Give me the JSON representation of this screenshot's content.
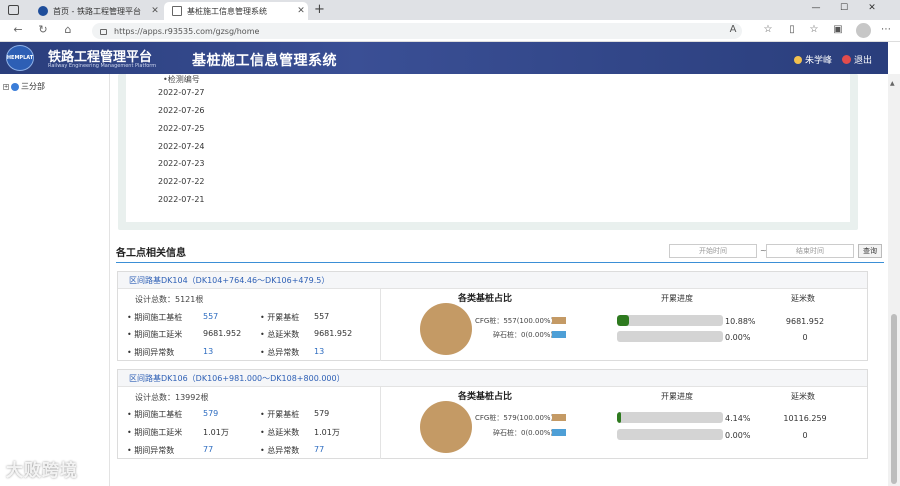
{
  "browser": {
    "tabs": [
      {
        "title": "首页 - 铁路工程管理平台"
      },
      {
        "title": "基桩施工信息管理系统"
      }
    ],
    "url": "https://apps.r93535.com/gzsg/home"
  },
  "header": {
    "logo_text": "HEMPLAT",
    "brand": "铁路工程管理平台",
    "brand_sub": "Railway Engineering Management Platform",
    "system_title": "基桩施工信息管理系统",
    "user_name": "朱学峰",
    "logout": "退出"
  },
  "tree": {
    "root_label": "三分部"
  },
  "date_panel": {
    "header": "•检测编号",
    "dates": [
      "2022-07-27",
      "2022-07-26",
      "2022-07-25",
      "2022-07-24",
      "2022-07-23",
      "2022-07-22",
      "2022-07-21"
    ]
  },
  "section": {
    "title": "各工点相关信息",
    "start_placeholder": "开始时间",
    "tilde": "~",
    "end_placeholder": "结束时间",
    "search": "查询"
  },
  "labels": {
    "period_piles": "• 期间施工基桩",
    "period_length": "• 期间施工延米",
    "period_abnormal": "• 期间异常数",
    "total_piles": "• 开累基桩",
    "total_length": "• 总延米数",
    "total_abnormal": "• 总异常数",
    "pie_title": "各类基桩占比",
    "progress_head": "开累进度",
    "ext_head": "延米数"
  },
  "sites": [
    {
      "name": "区间路基DK104（DK104+764.46～DK106+479.5）",
      "design_total": "设计总数：5121根",
      "period_piles": "557",
      "total_piles": "557",
      "period_length": "9681.952",
      "total_length": "9681.952",
      "period_abnormal": "13",
      "total_abnormal": "13",
      "legend": [
        {
          "label": "CFG桩：557(100.00%)",
          "color": "#c49a65"
        },
        {
          "label": "碎石桩：0(0.00%)",
          "color": "#4e9fd6"
        }
      ],
      "progress": [
        {
          "percent": 10.88,
          "text": "10.88%",
          "ext": "9681.952"
        },
        {
          "percent": 0,
          "text": "0.00%",
          "ext": "0"
        }
      ]
    },
    {
      "name": "区间路基DK106（DK106+981.000～DK108+800.000）",
      "design_total": "设计总数：13992根",
      "period_piles": "579",
      "total_piles": "579",
      "period_length": "1.01万",
      "total_length": "1.01万",
      "period_abnormal": "77",
      "total_abnormal": "77",
      "legend": [
        {
          "label": "CFG桩：579(100.00%)",
          "color": "#c49a65"
        },
        {
          "label": "碎石桩：0(0.00%)",
          "color": "#4e9fd6"
        }
      ],
      "progress": [
        {
          "percent": 4.14,
          "text": "4.14%",
          "ext": "10116.259"
        },
        {
          "percent": 0,
          "text": "0.00%",
          "ext": "0"
        }
      ]
    }
  ],
  "watermark": "大败跨境"
}
